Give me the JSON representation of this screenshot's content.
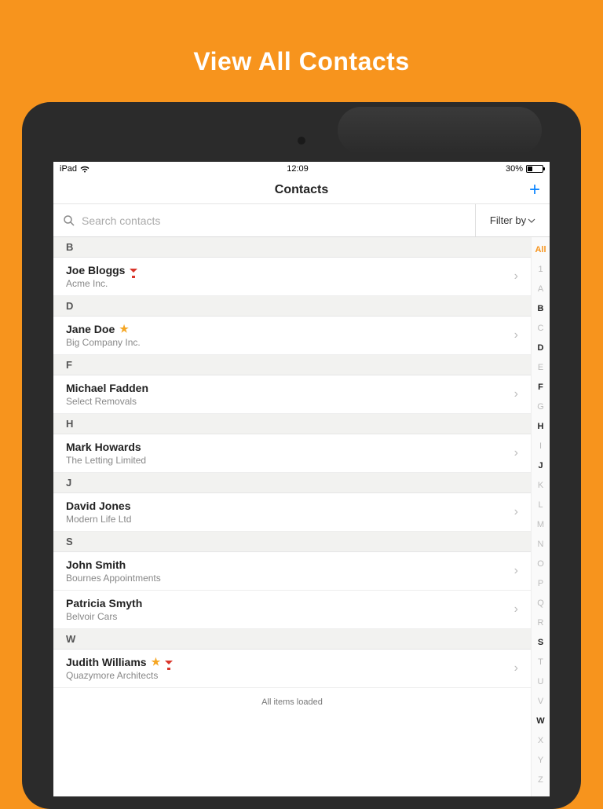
{
  "header": {
    "title": "View All Contacts"
  },
  "statusBar": {
    "device": "iPad",
    "time": "12:09",
    "battery": "30%"
  },
  "nav": {
    "title": "Contacts",
    "addLabel": "+"
  },
  "toolbar": {
    "searchPlaceholder": "Search contacts",
    "filterLabel": "Filter by"
  },
  "sections": [
    {
      "letter": "B",
      "contacts": [
        {
          "name": "Joe Bloggs",
          "company": "Acme Inc.",
          "star": false,
          "funnel": true
        }
      ]
    },
    {
      "letter": "D",
      "contacts": [
        {
          "name": "Jane Doe",
          "company": "Big Company Inc.",
          "star": true,
          "funnel": false
        }
      ]
    },
    {
      "letter": "F",
      "contacts": [
        {
          "name": "Michael Fadden",
          "company": "Select Removals",
          "star": false,
          "funnel": false
        }
      ]
    },
    {
      "letter": "H",
      "contacts": [
        {
          "name": "Mark Howards",
          "company": "The Letting Limited",
          "star": false,
          "funnel": false
        }
      ]
    },
    {
      "letter": "J",
      "contacts": [
        {
          "name": "David Jones",
          "company": "Modern Life Ltd",
          "star": false,
          "funnel": false
        }
      ]
    },
    {
      "letter": "S",
      "contacts": [
        {
          "name": "John Smith",
          "company": "Bournes Appointments",
          "star": false,
          "funnel": false
        },
        {
          "name": "Patricia Smyth",
          "company": "Belvoir Cars",
          "star": false,
          "funnel": false
        }
      ]
    },
    {
      "letter": "W",
      "contacts": [
        {
          "name": "Judith Williams",
          "company": "Quazymore Architects",
          "star": true,
          "funnel": true
        }
      ]
    }
  ],
  "footer": {
    "loadedMsg": "All items loaded"
  },
  "indexBar": {
    "items": [
      "All",
      "1",
      "A",
      "B",
      "C",
      "D",
      "E",
      "F",
      "G",
      "H",
      "I",
      "J",
      "K",
      "L",
      "M",
      "N",
      "O",
      "P",
      "Q",
      "R",
      "S",
      "T",
      "U",
      "V",
      "W",
      "X",
      "Y",
      "Z"
    ],
    "activeLetters": [
      "B",
      "D",
      "F",
      "H",
      "J",
      "S",
      "W"
    ]
  }
}
